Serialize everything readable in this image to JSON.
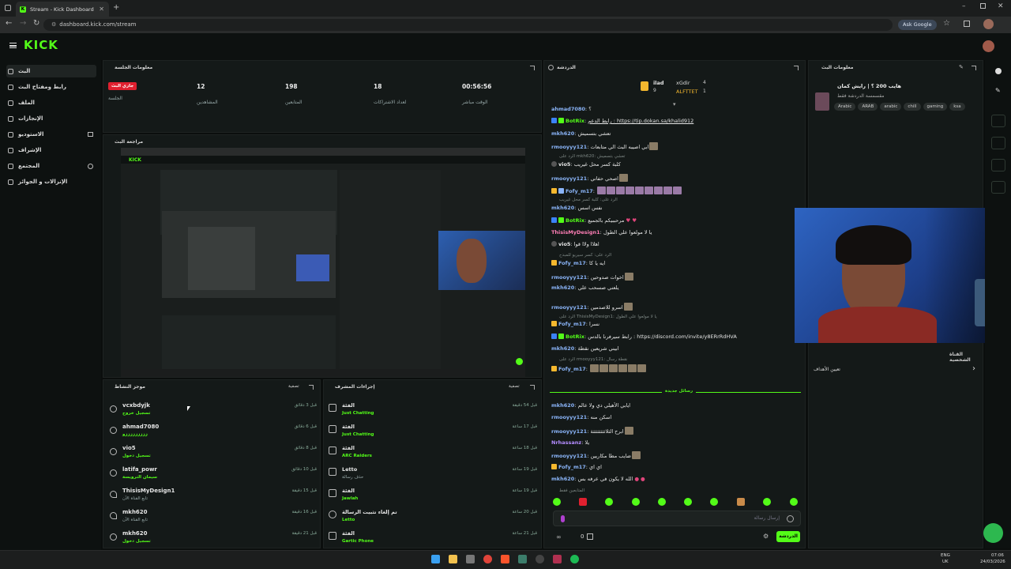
{
  "browser": {
    "tab_title": "Stream - Kick Dashboard",
    "url": "dashboard.kick.com/stream",
    "ask_google": "Ask Google"
  },
  "brand": {
    "logo": "KICK",
    "accent": "#53fc18"
  },
  "sidebar": {
    "items": [
      {
        "label": "البث",
        "icon": "live-icon",
        "active": true
      },
      {
        "label": "رابط ومفتاح البث",
        "icon": "key-icon"
      },
      {
        "label": "الملف",
        "icon": "profile-icon"
      },
      {
        "label": "الإنجازات",
        "icon": "trophy-icon"
      },
      {
        "label": "الاستوديو",
        "icon": "studio-icon"
      },
      {
        "label": "الإشراف",
        "icon": "shield-icon"
      },
      {
        "label": "المجتمع",
        "icon": "community-icon"
      },
      {
        "label": "الإنزالات و الجوائز",
        "icon": "gift-icon"
      }
    ]
  },
  "session": {
    "title": "معلومات الجلسة",
    "live_badge": "جاري البث",
    "live_label": "الجلسة",
    "viewers": "12",
    "viewers_label": "المشاهدين",
    "followers": "198",
    "followers_label": "المتابعين",
    "subs": "18",
    "subs_label": "لعداد الاشتراكات",
    "uptime": "00:56:56",
    "uptime_label": "الوقت مباشر"
  },
  "preview": {
    "title": "مراجعة البث"
  },
  "activity": {
    "title": "موجز النشاط",
    "settings": "تصفية",
    "rows": [
      {
        "name": "vcxbdyjk",
        "sub": "تسجيل خروج",
        "time": "قبل 3 دقائق"
      },
      {
        "name": "ahmad7080",
        "sub": "زززززززززو",
        "time": "قبل 6 دقائق"
      },
      {
        "name": "vio5",
        "sub": "تسجيل دخول",
        "time": "قبل 8 دقائق"
      },
      {
        "name": "latifa_powr",
        "sub": "سيمان الترويسة",
        "time": "قبل 10 دقائق"
      },
      {
        "name": "ThisisMyDesign1",
        "sub": "تابع القناة الآن",
        "time": "قبل 15 دقيقة"
      },
      {
        "name": "mkh620",
        "sub": "تابع القناة الآن",
        "time": "قبل 16 دقيقة"
      },
      {
        "name": "mkh620",
        "sub": "تسجيل دخول",
        "time": "قبل 21 دقيقة"
      }
    ]
  },
  "modlog": {
    "title": "إجراءات المشرف",
    "settings": "تصفية",
    "rows": [
      {
        "name": "الفئة",
        "sub": "Just Chatting",
        "time": "قبل 54 دقيقة"
      },
      {
        "name": "الفئة",
        "sub": "Just Chatting",
        "time": "قبل 17 ساعة"
      },
      {
        "name": "الفئة",
        "sub": "ARC Raiders",
        "time": "قبل 18 ساعة"
      },
      {
        "name": "Letto",
        "sub": "حذف رسالة",
        "time": "قبل 19 ساعة"
      },
      {
        "name": "الفئة",
        "sub": "Jawlah",
        "time": "قبل 19 ساعة"
      },
      {
        "name": "تم إلغاء تثبيت الرسالة",
        "sub": "Letto",
        "time": "قبل 20 ساعة"
      },
      {
        "name": "الفئة",
        "sub": "Gartic Phone",
        "time": "قبل 21 ساعة"
      }
    ]
  },
  "chat": {
    "title": "الدردشة",
    "top_user1": "xGdir",
    "top_user1_count": "4",
    "top_user2": "ALFTTET",
    "top_user2_count": "1",
    "top_user3": "ilad",
    "top_user3_count": "9",
    "new_messages": "رسائل جديدة",
    "input_placeholder": "إرسال رسالة",
    "send": "الدردشة",
    "counter": "0",
    "messages": [
      {
        "user": "ahmad7080",
        "text": "؟",
        "color": "#8ab4f8"
      },
      {
        "user": "BotRix",
        "text": "رابط الدعم : https://tip.dokan.sa/khalid912",
        "color": "#53fc18"
      },
      {
        "user": "mkh620",
        "text": "تعشي بتسميش",
        "color": "#8ab4f8"
      },
      {
        "user": "rmooyyy121",
        "text": "ابي اصيبه البث الي متابعات",
        "color": "#8ab4f8"
      },
      {
        "user": "vio5",
        "text": "كلبة كسر محل غيريب",
        "color": "#e6e6e6"
      },
      {
        "user": "rmooyyy121",
        "text": "اصحي حفاني",
        "color": "#8ab4f8"
      },
      {
        "user": "Fofy_m17",
        "text": "",
        "color": "#8ab4f8"
      },
      {
        "user": "mkh620",
        "text": "نفس اسس",
        "color": "#8ab4f8"
      },
      {
        "user": "BotRix",
        "text": "مرحببيكم بالجميع",
        "color": "#53fc18"
      },
      {
        "user": "ThisisMyDesign1",
        "text": "يا لا مولعوا علي الطول",
        "color": "#ff7eb6"
      },
      {
        "user": "vio5",
        "text": "اهلاا ولاا قوا",
        "color": "#e6e6e6"
      },
      {
        "user": "Fofy_m17",
        "text": "ايه يا كا",
        "color": "#8ab4f8"
      },
      {
        "user": "rmooyyy121",
        "text": "اخوات صدوحين",
        "color": "#8ab4f8"
      },
      {
        "user": "mkh620",
        "text": "يلعني صسحب علي",
        "color": "#8ab4f8"
      },
      {
        "user": "rmooyyy121",
        "text": "اسرو للاصدمين",
        "color": "#8ab4f8"
      },
      {
        "user": "Fofy_m17",
        "text": "نسرا",
        "color": "#8ab4f8"
      },
      {
        "user": "BotRix",
        "text": "رابط سيرفرنا بالدس : https://discord.com/invite/y8ERrRdHVA",
        "color": "#53fc18"
      },
      {
        "user": "mkh620",
        "text": "ابيني شريعين نقطة",
        "color": "#8ab4f8"
      },
      {
        "user": "Fofy_m17",
        "text": "",
        "color": "#8ab4f8"
      },
      {
        "user": "mkh620",
        "text": "ايابي الأهيلي دي ولا عالم",
        "color": "#8ab4f8"
      },
      {
        "user": "rmooyyy121",
        "text": "اسكن منه",
        "color": "#8ab4f8"
      },
      {
        "user": "rmooyyy121",
        "text": "ابرح الثلاثثثثثثثثة",
        "color": "#8ab4f8"
      },
      {
        "user": "Nrhassanz",
        "text": "يلا",
        "color": "#b48cff"
      },
      {
        "user": "rmooyyy121",
        "text": "ضايب مطا مكاريين",
        "color": "#8ab4f8"
      },
      {
        "user": "Fofy_m17",
        "text": "اي اي",
        "color": "#8ab4f8"
      },
      {
        "user": "mkh620",
        "text": "الله لا يكون في عرفه بس",
        "color": "#8ab4f8"
      }
    ],
    "replies": [
      "الرد على mkh620: تعشي بتسميش",
      "الرد على: كلبة كسر محل غيريب",
      "الرد على: كسر سيريو للمبدح",
      "الرد على rmooyyy121: ابي اصيبه البث الي متابعات",
      "الرد على Fofy_m17: ايه يا كا",
      "الرد على ThisisMyDesign1: يا لا مولعوا علي الطول",
      "الرد على rmooyyy121: نقطة رسال"
    ],
    "stream_readers": "المتابعين فقط"
  },
  "stream_info": {
    "title": "معلومات البث",
    "stream_title": "هايب 200 ؟ | رايش كمان",
    "category": "مقسمسة الدردشة فقط",
    "tags": [
      "Arabic",
      "ARAB",
      "arabic",
      "chill",
      "gaming",
      "ksa"
    ],
    "channel_points": "القناة الشخصية",
    "goals": "تعيين الأهداف"
  },
  "taskbar": {
    "lang": "ENG",
    "lang_sub": "UK",
    "time": "07:06",
    "date": "24/03/2026"
  }
}
